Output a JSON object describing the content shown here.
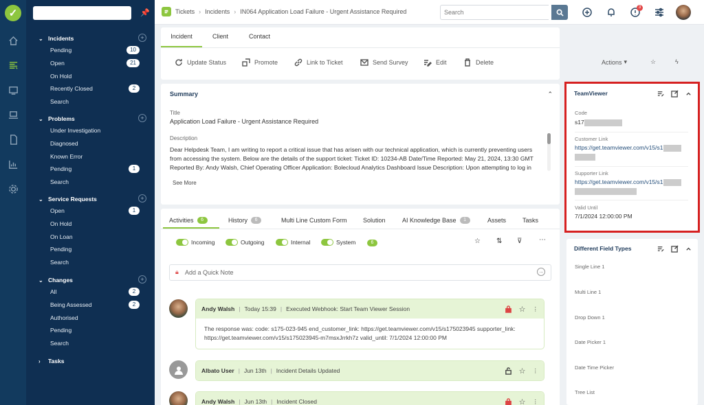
{
  "sidebar": {
    "sections": [
      {
        "title": "Incidents",
        "items": [
          {
            "label": "Pending",
            "count": "10"
          },
          {
            "label": "Open",
            "count": "21"
          },
          {
            "label": "On Hold"
          },
          {
            "label": "Recently Closed",
            "count": "2"
          },
          {
            "label": "Search"
          }
        ]
      },
      {
        "title": "Problems",
        "items": [
          {
            "label": "Under Investigation"
          },
          {
            "label": "Diagnosed"
          },
          {
            "label": "Known Error"
          },
          {
            "label": "Pending",
            "count": "1"
          },
          {
            "label": "Search"
          }
        ]
      },
      {
        "title": "Service Requests",
        "items": [
          {
            "label": "Open",
            "count": "1"
          },
          {
            "label": "On Hold"
          },
          {
            "label": "On Loan"
          },
          {
            "label": "Pending"
          },
          {
            "label": "Search"
          }
        ]
      },
      {
        "title": "Changes",
        "items": [
          {
            "label": "All",
            "count": "2"
          },
          {
            "label": "Being Assessed",
            "count": "2"
          },
          {
            "label": "Authorised"
          },
          {
            "label": "Pending"
          },
          {
            "label": "Search"
          }
        ]
      }
    ],
    "tasks_label": "Tasks"
  },
  "topbar": {
    "crumbs": [
      "Tickets",
      "Incidents",
      "IN064 Application Load Failure - Urgent Assistance Required"
    ],
    "search_placeholder": "Search",
    "notif_count": "3"
  },
  "ticket_tabs": [
    "Incident",
    "Client",
    "Contact"
  ],
  "actions": [
    "Update Status",
    "Promote",
    "Link to Ticket",
    "Send Survey",
    "Edit",
    "Delete"
  ],
  "actions_menu": "Actions",
  "summary": {
    "title": "Summary",
    "title_label": "Title",
    "title_value": "Application Load Failure - Urgent Assistance Required",
    "desc_label": "Description",
    "desc_value": "Dear Helpdesk Team, I am writing to report a critical issue that has arisen with our technical application, which is currently preventing users from accessing the system. Below are the details of the support ticket: Ticket ID: 10234-AB Date/Time Reported: May 21, 2024, 13:30 GMT Reported By: Andy Walsh, Chief Operating Officer Application: Bolecloud Analytics Dashboard Issue Description: Upon attempting to log in",
    "see_more": "See More"
  },
  "activity_tabs": [
    {
      "label": "Activities",
      "badge": "6"
    },
    {
      "label": "History",
      "badge": "6"
    },
    {
      "label": "Multi Line Custom Form"
    },
    {
      "label": "Solution"
    },
    {
      "label": "AI Knowledge Base",
      "badge": "1"
    },
    {
      "label": "Assets"
    },
    {
      "label": "Tasks"
    }
  ],
  "filters": [
    "Incoming",
    "Outgoing",
    "Internal",
    "System"
  ],
  "filter_count": "6",
  "quick_note_placeholder": "Add a Quick Note",
  "activities": [
    {
      "author": "Andy Walsh",
      "time": "Today 15:39",
      "subject": "Executed Webhook: Start Team Viewer Session",
      "body": "The response was: code: s175-023-945 end_customer_link: https://get.teamviewer.com/v15/s175023945 supporter_link: https://get.teamviewer.com/v15/s175023945-m7msxJrrkh7z valid_until: 7/1/2024 12:00:00 PM"
    },
    {
      "author": "Albato User",
      "time": "Jun 13th",
      "subject": "Incident Details Updated"
    },
    {
      "author": "Andy Walsh",
      "time": "Jun 13th",
      "subject": "Incident Closed"
    }
  ],
  "teamviewer": {
    "title": "TeamViewer",
    "code_label": "Code",
    "code_value": "s17",
    "customer_label": "Customer Link",
    "customer_value": "https://get.teamviewer.com/v15/s1",
    "supporter_label": "Supporter Link",
    "supporter_value": "https://get.teamviewer.com/v15/s1",
    "valid_label": "Valid Until",
    "valid_value": "7/1/2024 12:00:00 PM"
  },
  "field_types": {
    "title": "Different Field Types",
    "fields": [
      "Single Line 1",
      "Multi Line 1",
      "Drop Down 1",
      "Date Picker 1",
      "Date Time Picker",
      "Tree List"
    ]
  },
  "colors": {
    "accent": "#8dc63f",
    "nav": "#0f2f52",
    "highlight": "#d62020"
  }
}
